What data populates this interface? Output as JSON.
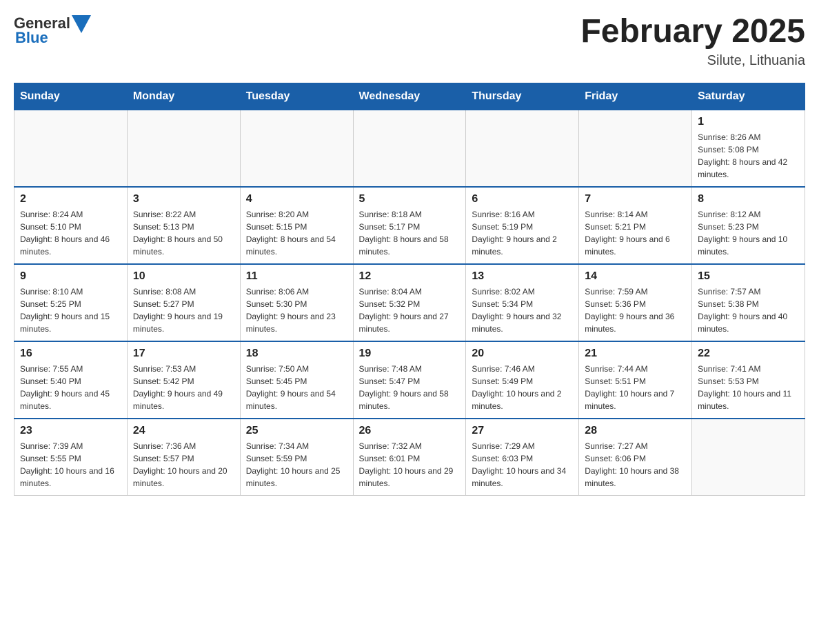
{
  "header": {
    "logo_general": "General",
    "logo_blue": "Blue",
    "title": "February 2025",
    "subtitle": "Silute, Lithuania"
  },
  "weekdays": [
    "Sunday",
    "Monday",
    "Tuesday",
    "Wednesday",
    "Thursday",
    "Friday",
    "Saturday"
  ],
  "weeks": [
    [
      {
        "day": "",
        "info": ""
      },
      {
        "day": "",
        "info": ""
      },
      {
        "day": "",
        "info": ""
      },
      {
        "day": "",
        "info": ""
      },
      {
        "day": "",
        "info": ""
      },
      {
        "day": "",
        "info": ""
      },
      {
        "day": "1",
        "info": "Sunrise: 8:26 AM\nSunset: 5:08 PM\nDaylight: 8 hours and 42 minutes."
      }
    ],
    [
      {
        "day": "2",
        "info": "Sunrise: 8:24 AM\nSunset: 5:10 PM\nDaylight: 8 hours and 46 minutes."
      },
      {
        "day": "3",
        "info": "Sunrise: 8:22 AM\nSunset: 5:13 PM\nDaylight: 8 hours and 50 minutes."
      },
      {
        "day": "4",
        "info": "Sunrise: 8:20 AM\nSunset: 5:15 PM\nDaylight: 8 hours and 54 minutes."
      },
      {
        "day": "5",
        "info": "Sunrise: 8:18 AM\nSunset: 5:17 PM\nDaylight: 8 hours and 58 minutes."
      },
      {
        "day": "6",
        "info": "Sunrise: 8:16 AM\nSunset: 5:19 PM\nDaylight: 9 hours and 2 minutes."
      },
      {
        "day": "7",
        "info": "Sunrise: 8:14 AM\nSunset: 5:21 PM\nDaylight: 9 hours and 6 minutes."
      },
      {
        "day": "8",
        "info": "Sunrise: 8:12 AM\nSunset: 5:23 PM\nDaylight: 9 hours and 10 minutes."
      }
    ],
    [
      {
        "day": "9",
        "info": "Sunrise: 8:10 AM\nSunset: 5:25 PM\nDaylight: 9 hours and 15 minutes."
      },
      {
        "day": "10",
        "info": "Sunrise: 8:08 AM\nSunset: 5:27 PM\nDaylight: 9 hours and 19 minutes."
      },
      {
        "day": "11",
        "info": "Sunrise: 8:06 AM\nSunset: 5:30 PM\nDaylight: 9 hours and 23 minutes."
      },
      {
        "day": "12",
        "info": "Sunrise: 8:04 AM\nSunset: 5:32 PM\nDaylight: 9 hours and 27 minutes."
      },
      {
        "day": "13",
        "info": "Sunrise: 8:02 AM\nSunset: 5:34 PM\nDaylight: 9 hours and 32 minutes."
      },
      {
        "day": "14",
        "info": "Sunrise: 7:59 AM\nSunset: 5:36 PM\nDaylight: 9 hours and 36 minutes."
      },
      {
        "day": "15",
        "info": "Sunrise: 7:57 AM\nSunset: 5:38 PM\nDaylight: 9 hours and 40 minutes."
      }
    ],
    [
      {
        "day": "16",
        "info": "Sunrise: 7:55 AM\nSunset: 5:40 PM\nDaylight: 9 hours and 45 minutes."
      },
      {
        "day": "17",
        "info": "Sunrise: 7:53 AM\nSunset: 5:42 PM\nDaylight: 9 hours and 49 minutes."
      },
      {
        "day": "18",
        "info": "Sunrise: 7:50 AM\nSunset: 5:45 PM\nDaylight: 9 hours and 54 minutes."
      },
      {
        "day": "19",
        "info": "Sunrise: 7:48 AM\nSunset: 5:47 PM\nDaylight: 9 hours and 58 minutes."
      },
      {
        "day": "20",
        "info": "Sunrise: 7:46 AM\nSunset: 5:49 PM\nDaylight: 10 hours and 2 minutes."
      },
      {
        "day": "21",
        "info": "Sunrise: 7:44 AM\nSunset: 5:51 PM\nDaylight: 10 hours and 7 minutes."
      },
      {
        "day": "22",
        "info": "Sunrise: 7:41 AM\nSunset: 5:53 PM\nDaylight: 10 hours and 11 minutes."
      }
    ],
    [
      {
        "day": "23",
        "info": "Sunrise: 7:39 AM\nSunset: 5:55 PM\nDaylight: 10 hours and 16 minutes."
      },
      {
        "day": "24",
        "info": "Sunrise: 7:36 AM\nSunset: 5:57 PM\nDaylight: 10 hours and 20 minutes."
      },
      {
        "day": "25",
        "info": "Sunrise: 7:34 AM\nSunset: 5:59 PM\nDaylight: 10 hours and 25 minutes."
      },
      {
        "day": "26",
        "info": "Sunrise: 7:32 AM\nSunset: 6:01 PM\nDaylight: 10 hours and 29 minutes."
      },
      {
        "day": "27",
        "info": "Sunrise: 7:29 AM\nSunset: 6:03 PM\nDaylight: 10 hours and 34 minutes."
      },
      {
        "day": "28",
        "info": "Sunrise: 7:27 AM\nSunset: 6:06 PM\nDaylight: 10 hours and 38 minutes."
      },
      {
        "day": "",
        "info": ""
      }
    ]
  ]
}
